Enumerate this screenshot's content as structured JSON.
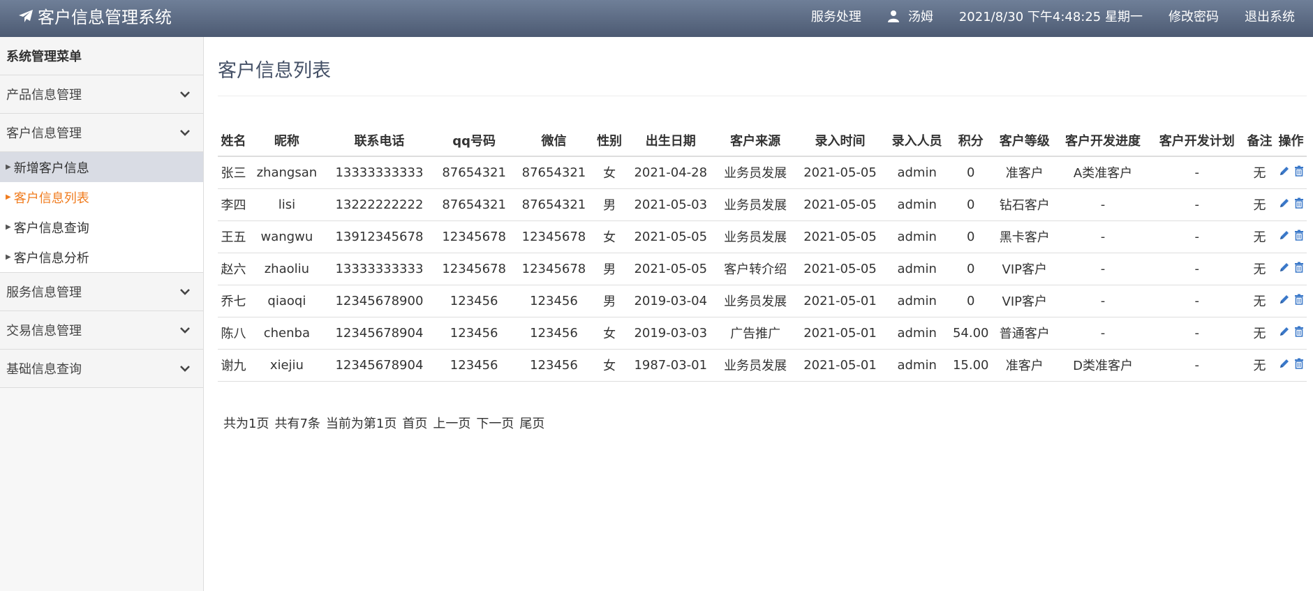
{
  "header": {
    "brand": "客户信息管理系统",
    "nav": {
      "service": "服务处理",
      "user": "汤姆",
      "datetime": "2021/8/30 下午4:48:25 星期一",
      "change_password": "修改密码",
      "logout": "退出系统"
    }
  },
  "sidebar": {
    "title": "系统管理菜单",
    "groups": [
      {
        "label": "产品信息管理"
      },
      {
        "label": "客户信息管理"
      },
      {
        "label": "服务信息管理"
      },
      {
        "label": "交易信息管理"
      },
      {
        "label": "基础信息查询"
      }
    ],
    "customer_items": [
      {
        "label": "新增客户信息"
      },
      {
        "label": "客户信息列表"
      },
      {
        "label": "客户信息查询"
      },
      {
        "label": "客户信息分析"
      }
    ]
  },
  "main": {
    "title": "客户信息列表",
    "columns": [
      "姓名",
      "昵称",
      "联系电话",
      "qq号码",
      "微信",
      "性别",
      "出生日期",
      "客户来源",
      "录入时间",
      "录入人员",
      "积分",
      "客户等级",
      "客户开发进度",
      "客户开发计划",
      "备注",
      "操作"
    ],
    "rows": [
      [
        "张三",
        "zhangsan",
        "13333333333",
        "87654321",
        "87654321",
        "女",
        "2021-04-28",
        "业务员发展",
        "2021-05-05",
        "admin",
        "0",
        "准客户",
        "A类准客户",
        "-",
        "无"
      ],
      [
        "李四",
        "lisi",
        "13222222222",
        "87654321",
        "87654321",
        "男",
        "2021-05-03",
        "业务员发展",
        "2021-05-05",
        "admin",
        "0",
        "钻石客户",
        "-",
        "-",
        "无"
      ],
      [
        "王五",
        "wangwu",
        "13912345678",
        "12345678",
        "12345678",
        "女",
        "2021-05-05",
        "业务员发展",
        "2021-05-05",
        "admin",
        "0",
        "黑卡客户",
        "-",
        "-",
        "无"
      ],
      [
        "赵六",
        "zhaoliu",
        "13333333333",
        "12345678",
        "12345678",
        "男",
        "2021-05-05",
        "客户转介绍",
        "2021-05-05",
        "admin",
        "0",
        "VIP客户",
        "-",
        "-",
        "无"
      ],
      [
        "乔七",
        "qiaoqi",
        "12345678900",
        "123456",
        "123456",
        "男",
        "2019-03-04",
        "业务员发展",
        "2021-05-01",
        "admin",
        "0",
        "VIP客户",
        "-",
        "-",
        "无"
      ],
      [
        "陈八",
        "chenba",
        "12345678904",
        "123456",
        "123456",
        "女",
        "2019-03-03",
        "广告推广",
        "2021-05-01",
        "admin",
        "54.00",
        "普通客户",
        "-",
        "-",
        "无"
      ],
      [
        "谢九",
        "xiejiu",
        "12345678904",
        "123456",
        "123456",
        "女",
        "1987-03-01",
        "业务员发展",
        "2021-05-01",
        "admin",
        "15.00",
        "准客户",
        "D类准客户",
        "-",
        "无"
      ]
    ],
    "pager": {
      "total_pages": "共为1页",
      "total_count": "共有7条",
      "current": "当前为第1页",
      "first": "首页",
      "prev": "上一页",
      "next": "下一页",
      "last": "尾页"
    }
  },
  "colors": {
    "header_top": "#6f7f98",
    "header_bottom": "#4c5a72",
    "active_menu": "#f07c1f",
    "icon_blue": "#3a78c9"
  }
}
